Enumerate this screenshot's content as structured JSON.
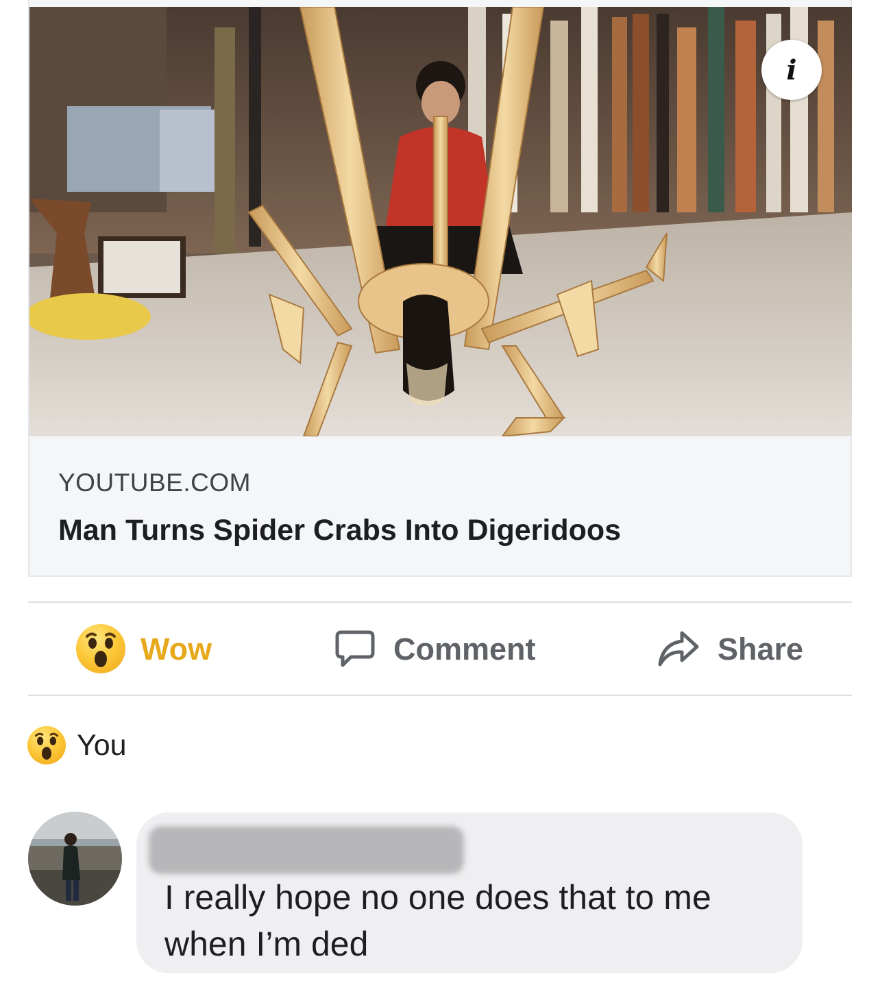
{
  "link_preview": {
    "domain": "YOUTUBE.COM",
    "title": "Man Turns Spider Crabs Into Digeridoos",
    "info_icon": "info-icon",
    "info_glyph": "i"
  },
  "actions": {
    "wow_label": "Wow",
    "wow_icon": "wow-emoji-icon",
    "comment_label": "Comment",
    "comment_icon": "comment-bubble-icon",
    "share_label": "Share",
    "share_icon": "share-arrow-icon"
  },
  "reactions": {
    "icon": "wow-emoji-icon",
    "text": "You"
  },
  "comment": {
    "author_redacted": true,
    "text": "I really hope no one does that to me when I’m ded"
  },
  "colors": {
    "wow_accent": "#e7a91b",
    "action_gray": "#5f6368",
    "bubble_bg": "#efeff1",
    "card_bg": "#f5f6f7"
  }
}
